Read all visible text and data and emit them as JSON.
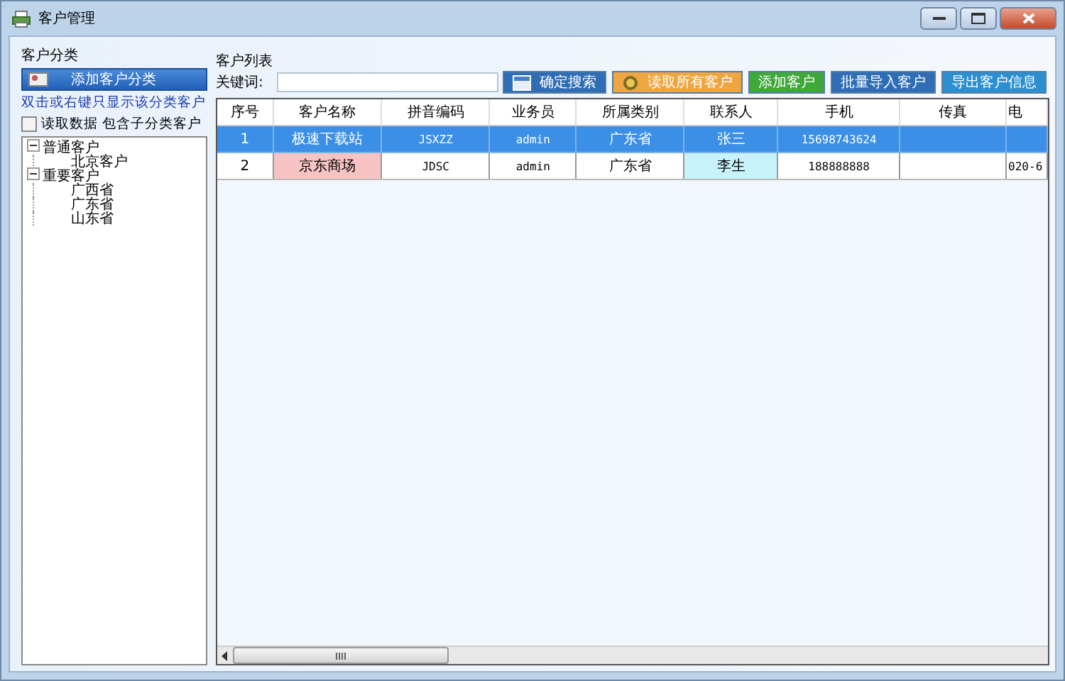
{
  "window": {
    "title": "客户管理"
  },
  "category_panel": {
    "label": "客户分类",
    "add_button": "添加客户分类",
    "hint": "双击或右键只显示该分类客户",
    "include_checkbox": {
      "label": "读取数据",
      "checked": false
    },
    "include_text": "包含子分类客户",
    "tree": [
      {
        "label": "普通客户",
        "expanded": true,
        "children": [
          {
            "label": "北京客户"
          }
        ]
      },
      {
        "label": "重要客户",
        "expanded": true,
        "children": [
          {
            "label": "广西省"
          },
          {
            "label": "广东省"
          },
          {
            "label": "山东省"
          }
        ]
      }
    ]
  },
  "customer_panel": {
    "label": "客户列表",
    "keyword_label": "关键词:",
    "buttons": [
      {
        "label": "确定搜索",
        "color": "#2f6db5",
        "kind": "search"
      },
      {
        "label": "读取所有客户",
        "color": "#f0a640",
        "kind": "read"
      },
      {
        "label": "添加客户",
        "color": "#3fa83a",
        "kind": "plain"
      },
      {
        "label": "批量导入客户",
        "color": "#2f6db5",
        "kind": "plain"
      },
      {
        "label": "导出客户信息",
        "color": "#2c8fd0",
        "kind": "plain"
      }
    ],
    "table": {
      "columns": [
        "序号",
        "客户名称",
        "拼音编码",
        "业务员",
        "所属类别",
        "联系人",
        "手机",
        "传真",
        "电"
      ],
      "rows": [
        {
          "selected": true,
          "cells": [
            {
              "text": "1"
            },
            {
              "text": "极速下载站"
            },
            {
              "text": "JSXZZ"
            },
            {
              "text": "admin"
            },
            {
              "text": "广东省"
            },
            {
              "text": "张三"
            },
            {
              "text": "15698743624"
            },
            null,
            null
          ]
        },
        {
          "selected": false,
          "cells": [
            {
              "text": "2"
            },
            {
              "text": "京东商场",
              "color": "#f7c3c3"
            },
            {
              "text": "JDSC"
            },
            {
              "text": "admin"
            },
            {
              "text": "广东省"
            },
            {
              "text": "李生",
              "color": "#c9f3fb"
            },
            {
              "text": "188888888"
            },
            null,
            {
              "text": "020-6"
            }
          ]
        }
      ]
    }
  }
}
